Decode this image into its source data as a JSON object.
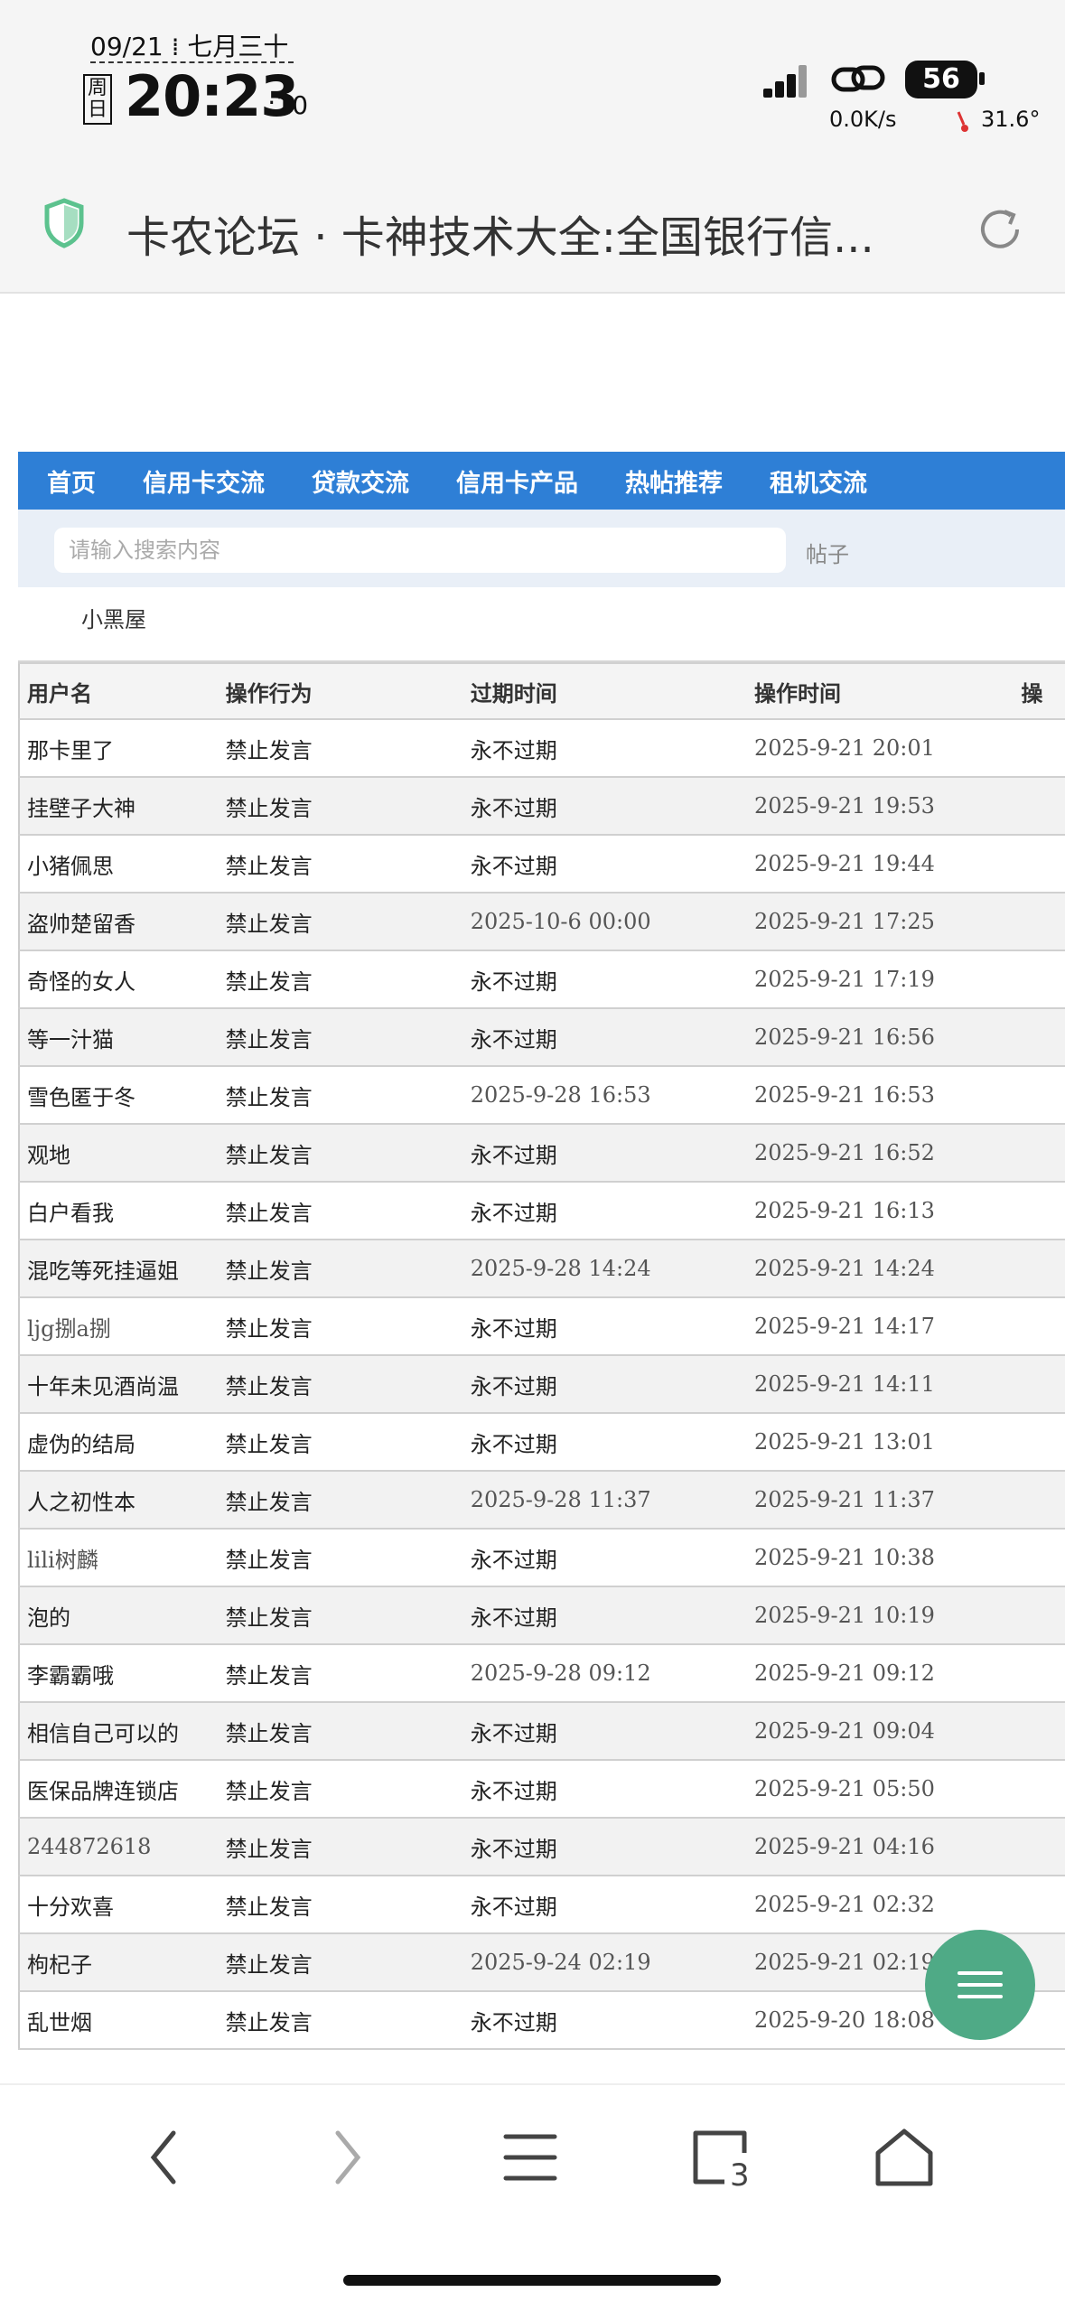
{
  "status_bar": {
    "date": "09/21 ⁞ 七月三十",
    "weekday": "周日",
    "time": "20:23",
    "seconds": ":10",
    "battery": "56",
    "net_speed": "0.0K/s",
    "temperature": "31.6°"
  },
  "browser": {
    "page_title": "卡农论坛 · 卡神技术大全:全国银行信..."
  },
  "nav": {
    "items": [
      "首页",
      "信用卡交流",
      "贷款交流",
      "信用卡产品",
      "热帖推荐",
      "租机交流"
    ]
  },
  "search": {
    "placeholder": "请输入搜索内容",
    "type": "帖子"
  },
  "section": {
    "title": "小黑屋"
  },
  "table": {
    "headers": [
      "用户名",
      "操作行为",
      "过期时间",
      "操作时间",
      "操"
    ],
    "rows": [
      [
        "那卡里了",
        "禁止发言",
        "永不过期",
        "2025-9-21 20:01"
      ],
      [
        "挂壁子大神",
        "禁止发言",
        "永不过期",
        "2025-9-21 19:53"
      ],
      [
        "小猪佩思",
        "禁止发言",
        "永不过期",
        "2025-9-21 19:44"
      ],
      [
        "盗帅楚留香",
        "禁止发言",
        "2025-10-6 00:00",
        "2025-9-21 17:25"
      ],
      [
        "奇怪的女人",
        "禁止发言",
        "永不过期",
        "2025-9-21 17:19"
      ],
      [
        "等一汁猫",
        "禁止发言",
        "永不过期",
        "2025-9-21 16:56"
      ],
      [
        "雪色匿于冬",
        "禁止发言",
        "2025-9-28 16:53",
        "2025-9-21 16:53"
      ],
      [
        "观地",
        "禁止发言",
        "永不过期",
        "2025-9-21 16:52"
      ],
      [
        "白户看我",
        "禁止发言",
        "永不过期",
        "2025-9-21 16:13"
      ],
      [
        "混吃等死挂逼姐",
        "禁止发言",
        "2025-9-28 14:24",
        "2025-9-21 14:24"
      ],
      [
        "ljg捌a捌",
        "禁止发言",
        "永不过期",
        "2025-9-21 14:17"
      ],
      [
        "十年未见酒尚温",
        "禁止发言",
        "永不过期",
        "2025-9-21 14:11"
      ],
      [
        "虚伪的结局",
        "禁止发言",
        "永不过期",
        "2025-9-21 13:01"
      ],
      [
        "人之初性本",
        "禁止发言",
        "2025-9-28 11:37",
        "2025-9-21 11:37"
      ],
      [
        "lili树麟",
        "禁止发言",
        "永不过期",
        "2025-9-21 10:38"
      ],
      [
        "泡的",
        "禁止发言",
        "永不过期",
        "2025-9-21 10:19"
      ],
      [
        "李霸霸哦",
        "禁止发言",
        "2025-9-28 09:12",
        "2025-9-21 09:12"
      ],
      [
        "相信自己可以的",
        "禁止发言",
        "永不过期",
        "2025-9-21 09:04"
      ],
      [
        "医保品牌连锁店",
        "禁止发言",
        "永不过期",
        "2025-9-21 05:50"
      ],
      [
        "244872618",
        "禁止发言",
        "永不过期",
        "2025-9-21 04:16"
      ],
      [
        "十分欢喜",
        "禁止发言",
        "永不过期",
        "2025-9-21 02:32"
      ],
      [
        "枸杞子",
        "禁止发言",
        "2025-9-24 02:19",
        "2025-9-21 02:19"
      ],
      [
        "乱世烟",
        "禁止发言",
        "永不过期",
        "2025-9-20 18:08"
      ]
    ]
  },
  "bottom_nav": {
    "tab_count": "3"
  },
  "colors": {
    "nav_bg": "#2e7fd6",
    "fab": "#4faa86",
    "shield": "#5cc28e"
  }
}
